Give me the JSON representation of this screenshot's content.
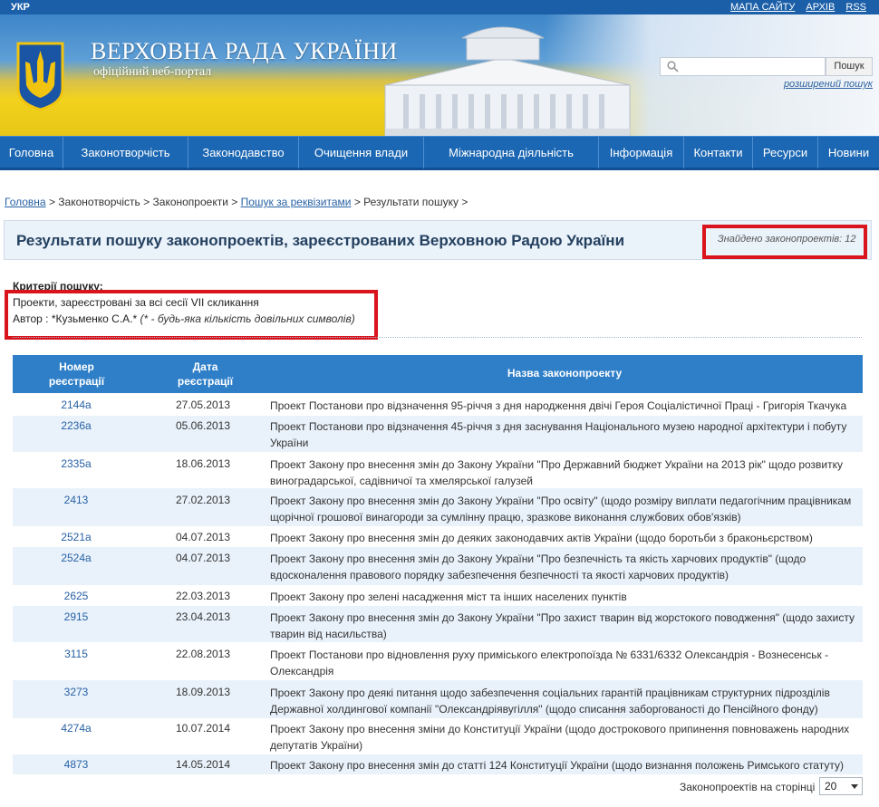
{
  "topbar": {
    "lang": "УКР",
    "links": [
      "МАПА САЙТУ",
      "АРХІВ",
      "RSS"
    ]
  },
  "header": {
    "title": "ВЕРХОВНА РАДА УКРАЇНИ",
    "subtitle": "офіційний веб-портал",
    "search_button": "Пошук",
    "advanced_search": "розширений пошук",
    "search_placeholder": ""
  },
  "nav": [
    "Головна",
    "Законотворчість",
    "Законодавство",
    "Очищення влади",
    "Міжнародна діяльність",
    "Інформація",
    "Контакти",
    "Ресурси",
    "Новини"
  ],
  "breadcrumb": {
    "home": "Головна",
    "sep": ">",
    "c1": "Законотворчість",
    "c2": "Законопроекти",
    "c3": "Пошук за реквізитами",
    "c4": "Результати пошуку"
  },
  "results": {
    "heading": "Результати пошуку законопроектів, зареєстрованих Верховною Радою України",
    "found": "Знайдено законопроектів: 12",
    "criteria_title": "Критерії пошуку:",
    "criteria_line1": "Проекти, зареєстровані за всі сесії VII скликання",
    "criteria_author": "Автор : *Кузьменко С.А.*",
    "criteria_note": "(* - будь-яка кількість довільних символів)"
  },
  "table": {
    "col_number": "Номер реєстрації",
    "col_date": "Дата реєстрації",
    "col_title": "Назва законопроекту",
    "rows": [
      {
        "num": "2144а",
        "date": "27.05.2013",
        "title": "Проект Постанови про відзначення 95-річчя з дня народження двічі Героя Соціалістичної Праці - Григорія Ткачука"
      },
      {
        "num": "2236а",
        "date": "05.06.2013",
        "title": "Проект Постанови про відзначення 45-річчя з дня заснування Національного музею народної архітектури і побуту України"
      },
      {
        "num": "2335а",
        "date": "18.06.2013",
        "title": "Проект Закону про внесення змін до Закону України \"Про Державний бюджет України на 2013 рік\" щодо розвитку виноградарської, садівничої та хмелярської галузей"
      },
      {
        "num": "2413",
        "date": "27.02.2013",
        "title": "Проект Закону про внесення змін до Закону України \"Про освіту\" (щодо розміру виплати педагогічним працівникам щорічної грошової винагороди за сумлінну працю, зразкове виконання службових обов'язків)"
      },
      {
        "num": "2521а",
        "date": "04.07.2013",
        "title": "Проект Закону про внесення змін до деяких законодавчих актів України (щодо боротьби з браконьєрством)"
      },
      {
        "num": "2524а",
        "date": "04.07.2013",
        "title": "Проект Закону про внесення змін до Закону України \"Про безпечність та якість харчових продуктів\" (щодо вдосконалення правового порядку забезпечення безпечності та якості харчових продуктів)"
      },
      {
        "num": "2625",
        "date": "22.03.2013",
        "title": "Проект Закону про зелені насадження міст та інших населених пунктів"
      },
      {
        "num": "2915",
        "date": "23.04.2013",
        "title": "Проект Закону про внесення змін до Закону України \"Про захист тварин від жорстокого поводження\" (щодо захисту тварин від насильства)"
      },
      {
        "num": "3115",
        "date": "22.08.2013",
        "title": "Проект Постанови про відновлення руху приміського електропоїзда № 6331/6332 Олександрія - Вознесенськ - Олександрія"
      },
      {
        "num": "3273",
        "date": "18.09.2013",
        "title": "Проект Закону про деякі питання щодо забезпечення соціальних гарантій працівникам структурних підрозділів Державної холдингової компанії \"Олександріявугілля\" (щодо списання заборгованості до Пенсійного фонду)"
      },
      {
        "num": "4274а",
        "date": "10.07.2014",
        "title": "Проект Закону про внесення зміни до Конституції України (щодо дострокового припинення повноважень народних депутатів України)"
      },
      {
        "num": "4873",
        "date": "14.05.2014",
        "title": "Проект Закону про внесення змін до статті 124 Конституції України (щодо визнання положень Римського статуту)"
      }
    ]
  },
  "pager": {
    "label": "Законопроектів на сторінці",
    "value": "20"
  },
  "colors": {
    "nav": "#1c67b3",
    "table_header": "#2f7fc8",
    "highlight": "#d9141d"
  }
}
